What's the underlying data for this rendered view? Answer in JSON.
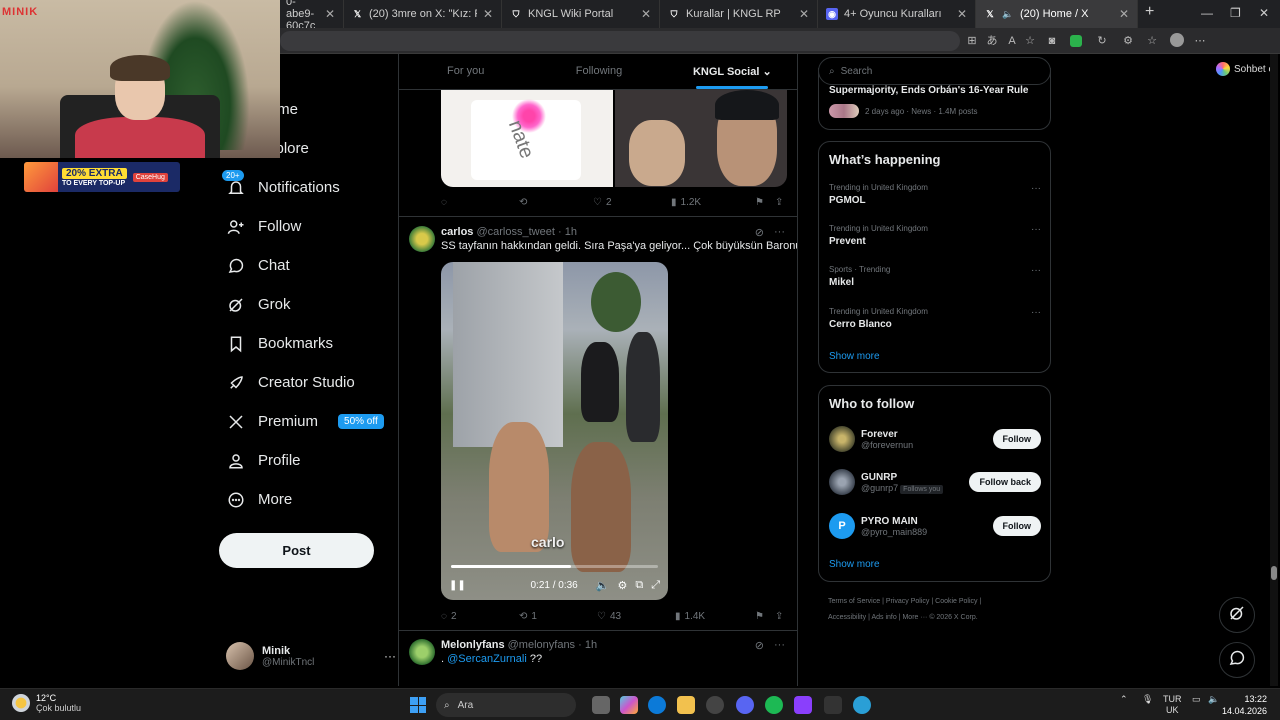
{
  "browser": {
    "tabs": [
      {
        "label": "0-abe9-60c7c",
        "icon": "page-icon",
        "active": false
      },
      {
        "label": "(20) 3mre on X: \"Kız: Romantik erk",
        "icon": "x-logo-icon",
        "active": false
      },
      {
        "label": "KNGL Wiki Portal",
        "icon": "shield-icon",
        "active": false
      },
      {
        "label": "Kurallar | KNGL RP",
        "icon": "shield-icon",
        "active": false
      },
      {
        "label": "4+ Oyuncu Kuralları",
        "icon": "discord-icon",
        "active": false
      },
      {
        "label": "(20) Home / X",
        "icon": "x-logo-icon",
        "active": true
      }
    ],
    "copilot_label": "Sohbet et"
  },
  "overlay": {
    "brand": "MINIK",
    "promo_line1": "20% EXTRA",
    "promo_line2": "TO EVERY TOP-UP",
    "promo_brand": "CaseHug"
  },
  "sidebar": {
    "items": [
      {
        "label": "Home",
        "icon": "home-icon"
      },
      {
        "label": "Explore",
        "icon": "search-icon"
      },
      {
        "label": "Notifications",
        "icon": "bell-icon",
        "badge": "20+"
      },
      {
        "label": "Follow",
        "icon": "add-person-icon"
      },
      {
        "label": "Chat",
        "icon": "chat-bubble-icon"
      },
      {
        "label": "Grok",
        "icon": "grok-icon"
      },
      {
        "label": "Bookmarks",
        "icon": "bookmark-icon"
      },
      {
        "label": "Creator Studio",
        "icon": "rocket-icon"
      },
      {
        "label": "Premium",
        "icon": "x-logo-icon",
        "pill": "50% off"
      },
      {
        "label": "Profile",
        "icon": "person-icon"
      },
      {
        "label": "More",
        "icon": "more-circle-icon"
      }
    ],
    "post_label": "Post",
    "account": {
      "name": "Minik",
      "handle": "@MinikTncl"
    }
  },
  "feed": {
    "tabs": [
      "For you",
      "Following",
      "KNGL Social"
    ],
    "active_tab": "KNGL Social",
    "post1_actions": {
      "replies": "",
      "reposts": "",
      "likes": "2",
      "views": "1.2K"
    },
    "tweet2": {
      "name": "carlos",
      "handle": "@carloss_tweet",
      "time": "1h",
      "text": "SS tayfanın hakkından geldi. Sıra Paşa'ya geliyor... Çok büyüksün Baronum.",
      "video_overlay_text": "carlo",
      "video_time": "0:21 / 0:36",
      "video_progress": 0.58,
      "replies": "2",
      "reposts": "1",
      "likes": "43",
      "views": "1.4K"
    },
    "tweet3": {
      "name": "Melonlyfans",
      "handle": "@melonyfans",
      "time": "1h",
      "text_prefix": ".",
      "mention": "@SercanZurnali",
      "text_suffix": " ??"
    }
  },
  "right": {
    "search_placeholder": "Search",
    "news": {
      "title": "Supermajority, Ends Orbán's 16-Year Rule",
      "meta": "2 days ago · News · 1.4M posts"
    },
    "happening_title": "What’s happening",
    "trends": [
      {
        "context": "Trending in United Kingdom",
        "title": "PGMOL"
      },
      {
        "context": "Trending in United Kingdom",
        "title": "Prevent"
      },
      {
        "context": "Sports · Trending",
        "title": "Mikel"
      },
      {
        "context": "Trending in United Kingdom",
        "title": "Cerro Blanco"
      }
    ],
    "show_more": "Show more",
    "who_title": "Who to follow",
    "who": [
      {
        "name": "Forever",
        "handle": "@forevernun",
        "button": "Follow",
        "follows_you": ""
      },
      {
        "name": "GUNRP",
        "handle": "@gunrp7",
        "button": "Follow back",
        "follows_you": "Follows you"
      },
      {
        "name": "PYRO MAIN",
        "handle": "@pyro_main889",
        "button": "Follow",
        "follows_you": "",
        "initial": "P"
      }
    ],
    "footer": [
      "Terms of Service",
      "Privacy Policy",
      "Cookie Policy",
      "Accessibility",
      "Ads info",
      "More ···",
      "© 2026 X Corp."
    ]
  },
  "taskbar": {
    "temp": "12°C",
    "weather": "Çok bulutlu",
    "search_label": "Ara",
    "lang1": "TUR",
    "lang2": "UK",
    "time": "13:22",
    "date": "14.04.2026"
  },
  "colors": {
    "accent": "#1d9bf0",
    "background": "#000000",
    "border": "#2f3336",
    "muted": "#71767b"
  }
}
